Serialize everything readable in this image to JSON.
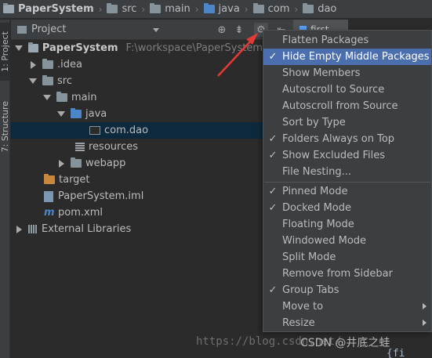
{
  "breadcrumb": [
    "PaperSystem",
    "src",
    "main",
    "java",
    "com",
    "dao"
  ],
  "tool_stripe": {
    "project_tab": "1: Project",
    "structure_tab": "7: Structure"
  },
  "panel": {
    "title": "Project",
    "editor_tab": "first"
  },
  "tree": [
    {
      "label": "PaperSystem",
      "hint": "F:\\workspace\\PaperSystem"
    },
    {
      "label": ".idea"
    },
    {
      "label": "src"
    },
    {
      "label": "main"
    },
    {
      "label": "java"
    },
    {
      "label": "com.dao"
    },
    {
      "label": "resources"
    },
    {
      "label": "webapp"
    },
    {
      "label": "target"
    },
    {
      "label": "PaperSystem.iml"
    },
    {
      "label": "pom.xml"
    },
    {
      "label": "External Libraries"
    }
  ],
  "menu": [
    {
      "label": "Flatten Packages",
      "checked": false
    },
    {
      "label": "Hide Empty Middle Packages",
      "checked": true,
      "hovered": true
    },
    {
      "label": "Show Members",
      "checked": false
    },
    {
      "label": "Autoscroll to Source",
      "checked": false
    },
    {
      "label": "Autoscroll from Source",
      "checked": false
    },
    {
      "label": "Sort by Type",
      "checked": false
    },
    {
      "label": "Folders Always on Top",
      "checked": true
    },
    {
      "label": "Show Excluded Files",
      "checked": true
    },
    {
      "label": "File Nesting...",
      "checked": false
    },
    {
      "label": "Pinned Mode",
      "checked": true
    },
    {
      "label": "Docked Mode",
      "checked": true
    },
    {
      "label": "Floating Mode",
      "checked": false
    },
    {
      "label": "Windowed Mode",
      "checked": false
    },
    {
      "label": "Split Mode",
      "checked": false
    },
    {
      "label": "Remove from Sidebar",
      "checked": false
    },
    {
      "label": "Group Tabs",
      "checked": true
    },
    {
      "label": "Move to",
      "checked": false,
      "submenu": true
    },
    {
      "label": "Resize",
      "checked": false,
      "submenu": true
    }
  ],
  "watermark": {
    "url": "https://blog.csdn.net/",
    "csdn": "CSDN @井底之蛙",
    "code": "{fi"
  },
  "colors": {
    "menu_highlight": "#4b6eaf",
    "selection": "#0d293e",
    "annotation_arrow": "#e53935"
  }
}
